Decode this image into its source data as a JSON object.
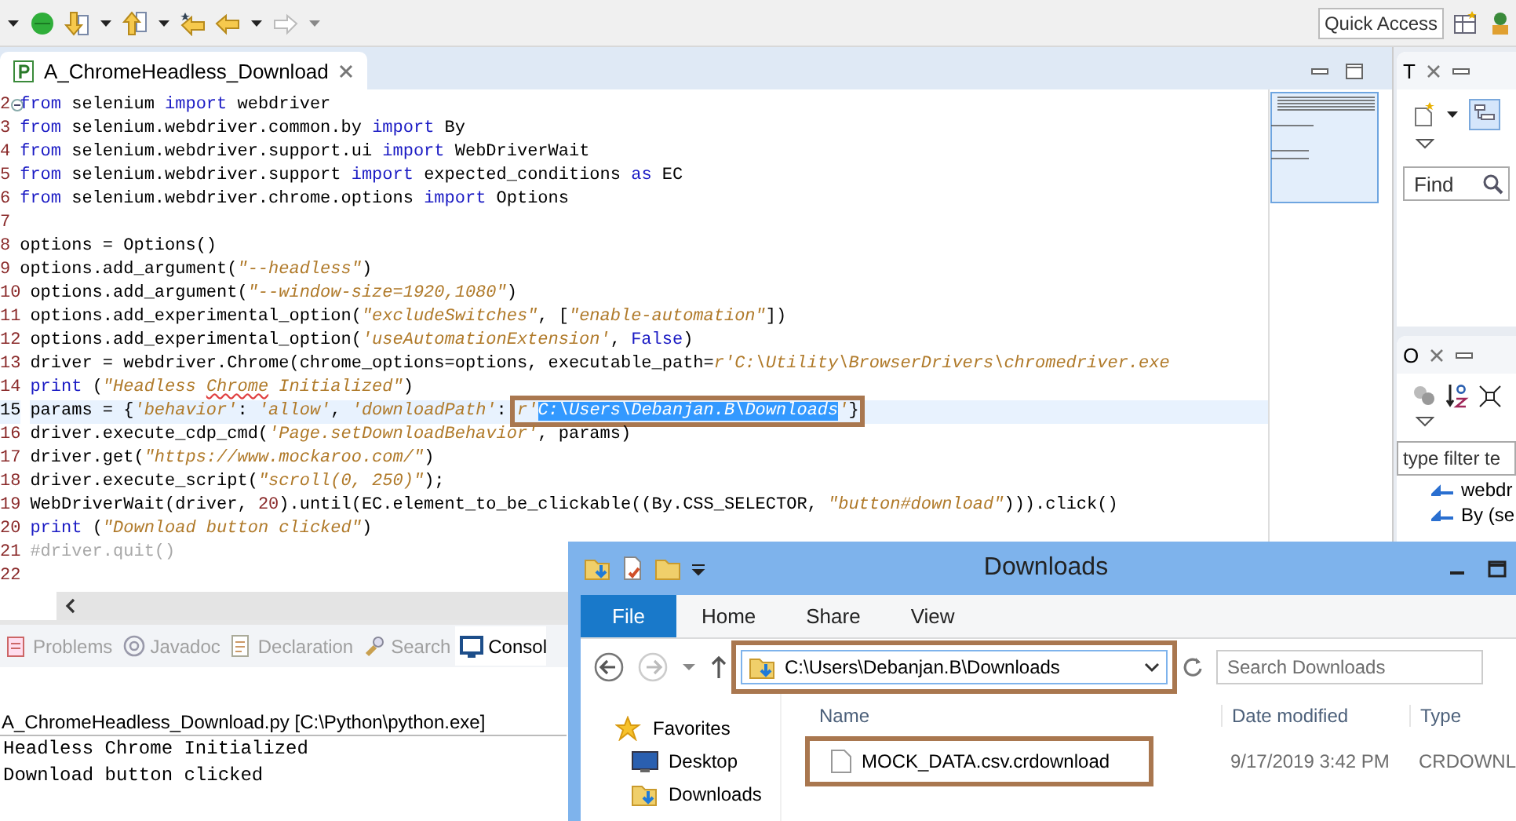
{
  "toolbar": {
    "quick_access": "Quick Access"
  },
  "editor": {
    "tab": {
      "label": "A_ChromeHeadless_Download",
      "selected": true
    },
    "lines": [
      {
        "number": "2",
        "fold": true,
        "current": false,
        "tokens": [
          {
            "kind": "kw",
            "text": "from"
          },
          {
            "kind": "plain",
            "text": " selenium "
          },
          {
            "kind": "kw",
            "text": "import"
          },
          {
            "kind": "plain",
            "text": " webdriver"
          }
        ]
      },
      {
        "number": "3",
        "fold": false,
        "current": false,
        "tokens": [
          {
            "kind": "kw",
            "text": "from"
          },
          {
            "kind": "plain",
            "text": " selenium.webdriver.common.by "
          },
          {
            "kind": "kw",
            "text": "import"
          },
          {
            "kind": "plain",
            "text": " By"
          }
        ]
      },
      {
        "number": "4",
        "fold": false,
        "current": false,
        "tokens": [
          {
            "kind": "kw",
            "text": "from"
          },
          {
            "kind": "plain",
            "text": " selenium.webdriver.support.ui "
          },
          {
            "kind": "kw",
            "text": "import"
          },
          {
            "kind": "plain",
            "text": " WebDriverWait"
          }
        ]
      },
      {
        "number": "5",
        "fold": false,
        "current": false,
        "tokens": [
          {
            "kind": "kw",
            "text": "from"
          },
          {
            "kind": "plain",
            "text": " selenium.webdriver.support "
          },
          {
            "kind": "kw",
            "text": "import"
          },
          {
            "kind": "plain",
            "text": " expected_conditions "
          },
          {
            "kind": "kw",
            "text": "as"
          },
          {
            "kind": "plain",
            "text": " EC"
          }
        ]
      },
      {
        "number": "6",
        "fold": false,
        "current": false,
        "tokens": [
          {
            "kind": "kw",
            "text": "from"
          },
          {
            "kind": "plain",
            "text": " selenium.webdriver.chrome.options "
          },
          {
            "kind": "kw",
            "text": "import"
          },
          {
            "kind": "plain",
            "text": " Options"
          }
        ]
      },
      {
        "number": "7",
        "fold": false,
        "current": false
      },
      {
        "number": "8",
        "fold": false,
        "current": false,
        "tokens": [
          {
            "kind": "plain",
            "text": "options = Options()"
          }
        ]
      },
      {
        "number": "9",
        "fold": false,
        "current": false,
        "tokens": [
          {
            "kind": "plain",
            "text": "options.add_argument("
          },
          {
            "kind": "str",
            "text": "\"--headless\""
          },
          {
            "kind": "plain",
            "text": ")"
          }
        ]
      },
      {
        "number": "10",
        "fold": false,
        "current": false,
        "tokens": [
          {
            "kind": "plain",
            "text": "options.add_argument("
          },
          {
            "kind": "str",
            "text": "\"--window-size=1920,1080\""
          },
          {
            "kind": "plain",
            "text": ")"
          }
        ]
      },
      {
        "number": "11",
        "fold": false,
        "current": false,
        "tokens": [
          {
            "kind": "plain",
            "text": "options.add_experimental_option("
          },
          {
            "kind": "str",
            "text": "\"excludeSwitches\""
          },
          {
            "kind": "plain",
            "text": ", ["
          },
          {
            "kind": "str",
            "text": "\"enable-automation\""
          },
          {
            "kind": "plain",
            "text": "])"
          }
        ]
      },
      {
        "number": "12",
        "fold": false,
        "current": false,
        "tokens": [
          {
            "kind": "plain",
            "text": "options.add_experimental_option("
          },
          {
            "kind": "str",
            "text": "'useAutomationExtension'"
          },
          {
            "kind": "plain",
            "text": ", "
          },
          {
            "kind": "kw",
            "text": "False"
          },
          {
            "kind": "plain",
            "text": ")"
          }
        ]
      },
      {
        "number": "13",
        "fold": false,
        "current": false,
        "tokens": [
          {
            "kind": "plain",
            "text": "driver = webdriver.Chrome(chrome_options=options, executable_path="
          },
          {
            "kind": "str",
            "text": "r'C:\\Utility\\BrowserDrivers\\chromedriver.exe"
          }
        ]
      },
      {
        "number": "14",
        "fold": false,
        "current": false,
        "tokens": [
          {
            "kind": "kw",
            "text": "print"
          },
          {
            "kind": "plain",
            "text": " ("
          },
          {
            "kind": "str",
            "text": "\"Headless "
          },
          {
            "kind": "misspelled",
            "text": "Chrome"
          },
          {
            "kind": "str",
            "text": " Initialized\""
          },
          {
            "kind": "plain",
            "text": ")"
          }
        ]
      },
      {
        "number": "15",
        "fold": false,
        "current": true,
        "tokens": [
          {
            "kind": "plain",
            "text": "params = {"
          },
          {
            "kind": "str",
            "text": "'behavior'"
          },
          {
            "kind": "plain",
            "text": ": "
          },
          {
            "kind": "str",
            "text": "'allow'"
          },
          {
            "kind": "plain",
            "text": ", "
          },
          {
            "kind": "str",
            "text": "'downloadPath'"
          },
          {
            "kind": "plain",
            "text": ": "
          }
        ],
        "boxed_tokens": [
          {
            "kind": "str",
            "text": "r'"
          },
          {
            "kind": "selected",
            "text": "C:\\Users\\Debanjan.B\\Downloads"
          },
          {
            "kind": "str",
            "text": "'"
          },
          {
            "kind": "plain",
            "text": "}"
          }
        ]
      },
      {
        "number": "16",
        "fold": false,
        "current": false,
        "tokens": [
          {
            "kind": "plain",
            "text": "driver.execute_cdp_cmd("
          },
          {
            "kind": "str",
            "text": "'Page.setDownloadBehavior'"
          },
          {
            "kind": "plain",
            "text": ", params)"
          }
        ]
      },
      {
        "number": "17",
        "fold": false,
        "current": false,
        "tokens": [
          {
            "kind": "plain",
            "text": "driver.get("
          },
          {
            "kind": "str",
            "text": "\"https://www.mockaroo.com/\""
          },
          {
            "kind": "plain",
            "text": ")"
          }
        ]
      },
      {
        "number": "18",
        "fold": false,
        "current": false,
        "tokens": [
          {
            "kind": "plain",
            "text": "driver.execute_script("
          },
          {
            "kind": "str",
            "text": "\"scroll(0, 250)\""
          },
          {
            "kind": "plain",
            "text": ");"
          }
        ]
      },
      {
        "number": "19",
        "fold": false,
        "current": false,
        "tokens": [
          {
            "kind": "plain",
            "text": "WebDriverWait(driver, "
          },
          {
            "kind": "num",
            "text": "20"
          },
          {
            "kind": "plain",
            "text": ").until(EC.element_to_be_clickable((By.CSS_SELECTOR, "
          },
          {
            "kind": "str",
            "text": "\"button#download\""
          },
          {
            "kind": "plain",
            "text": "))).click()"
          }
        ]
      },
      {
        "number": "20",
        "fold": false,
        "current": false,
        "tokens": [
          {
            "kind": "kw",
            "text": "print"
          },
          {
            "kind": "plain",
            "text": " ("
          },
          {
            "kind": "str",
            "text": "\"Download button clicked\""
          },
          {
            "kind": "plain",
            "text": ")"
          }
        ]
      },
      {
        "number": "21",
        "fold": false,
        "current": false,
        "tokens": [
          {
            "kind": "comment",
            "text": "#driver.quit()"
          }
        ]
      },
      {
        "number": "22",
        "fold": false,
        "current": false
      }
    ]
  },
  "bottom_panel": {
    "tabs": [
      {
        "kind": "problems",
        "label": "Problems",
        "selected": false
      },
      {
        "kind": "javadoc",
        "label": "Javadoc",
        "selected": false
      },
      {
        "kind": "declaration",
        "label": "Declaration",
        "selected": false
      },
      {
        "kind": "search",
        "label": "Search",
        "selected": false
      },
      {
        "kind": "console",
        "label": "Consol",
        "selected": true
      }
    ],
    "console_title": "A_ChromeHeadless_Download.py [C:\\Python\\python.exe]",
    "output": [
      "Headless Chrome Initialized",
      "Download button clicked"
    ]
  },
  "task_panel": {
    "tab": "T",
    "find": {
      "placeholder": "Find"
    }
  },
  "outline_panel": {
    "tab": "O",
    "filter": {
      "placeholder": "type filter te"
    },
    "items": [
      {
        "label": "webdr"
      },
      {
        "label": "By (se"
      }
    ]
  },
  "explorer": {
    "title": "Downloads",
    "ribbon_tabs": [
      {
        "kind": "file",
        "label": "File"
      },
      {
        "kind": "tab",
        "label": "Home"
      },
      {
        "kind": "tab",
        "label": "Share"
      },
      {
        "kind": "tab",
        "label": "View"
      }
    ],
    "address": {
      "value": "C:\\Users\\Debanjan.B\\Downloads",
      "highlighted": true
    },
    "search": {
      "placeholder": "Search Downloads"
    },
    "nav": [
      {
        "kind": "favorites",
        "label": "Favorites"
      },
      {
        "kind": "desktop",
        "label": "Desktop"
      },
      {
        "kind": "downloads",
        "label": "Downloads"
      }
    ],
    "columns": [
      "Name",
      "Date modified",
      "Type"
    ],
    "rows": [
      {
        "cells": [
          "MOCK_DATA.csv.crdownload",
          "9/17/2019 3:42 PM",
          "CRDOWNL"
        ],
        "highlighted": true
      }
    ]
  }
}
